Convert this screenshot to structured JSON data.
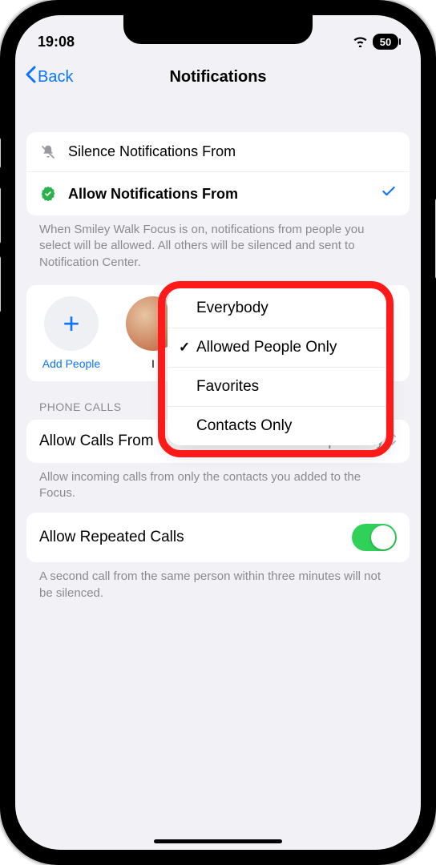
{
  "status": {
    "time": "19:08",
    "battery": "50"
  },
  "nav": {
    "back": "Back",
    "title": "Notifications"
  },
  "mode": {
    "silence_label": "Silence Notifications From",
    "allow_label": "Allow Notifications From",
    "description": "When Smiley Walk Focus is on, notifications from people you select will be allowed. All others will be silenced and sent to Notification Center."
  },
  "people": {
    "add_label": "Add People",
    "contact_partial": "I"
  },
  "phone": {
    "section_header": "PHONE CALLS",
    "allow_calls_label": "Allow Calls From",
    "allow_calls_value": "Allowed People Only",
    "allow_calls_desc": "Allow incoming calls from only the contacts you added to the Focus.",
    "repeated_label": "Allow Repeated Calls",
    "repeated_desc": "A second call from the same person within three minutes will not be silenced."
  },
  "popover": {
    "options": [
      {
        "label": "Everybody",
        "checked": false
      },
      {
        "label": "Allowed People Only",
        "checked": true
      },
      {
        "label": "Favorites",
        "checked": false
      },
      {
        "label": "Contacts Only",
        "checked": false
      }
    ]
  }
}
